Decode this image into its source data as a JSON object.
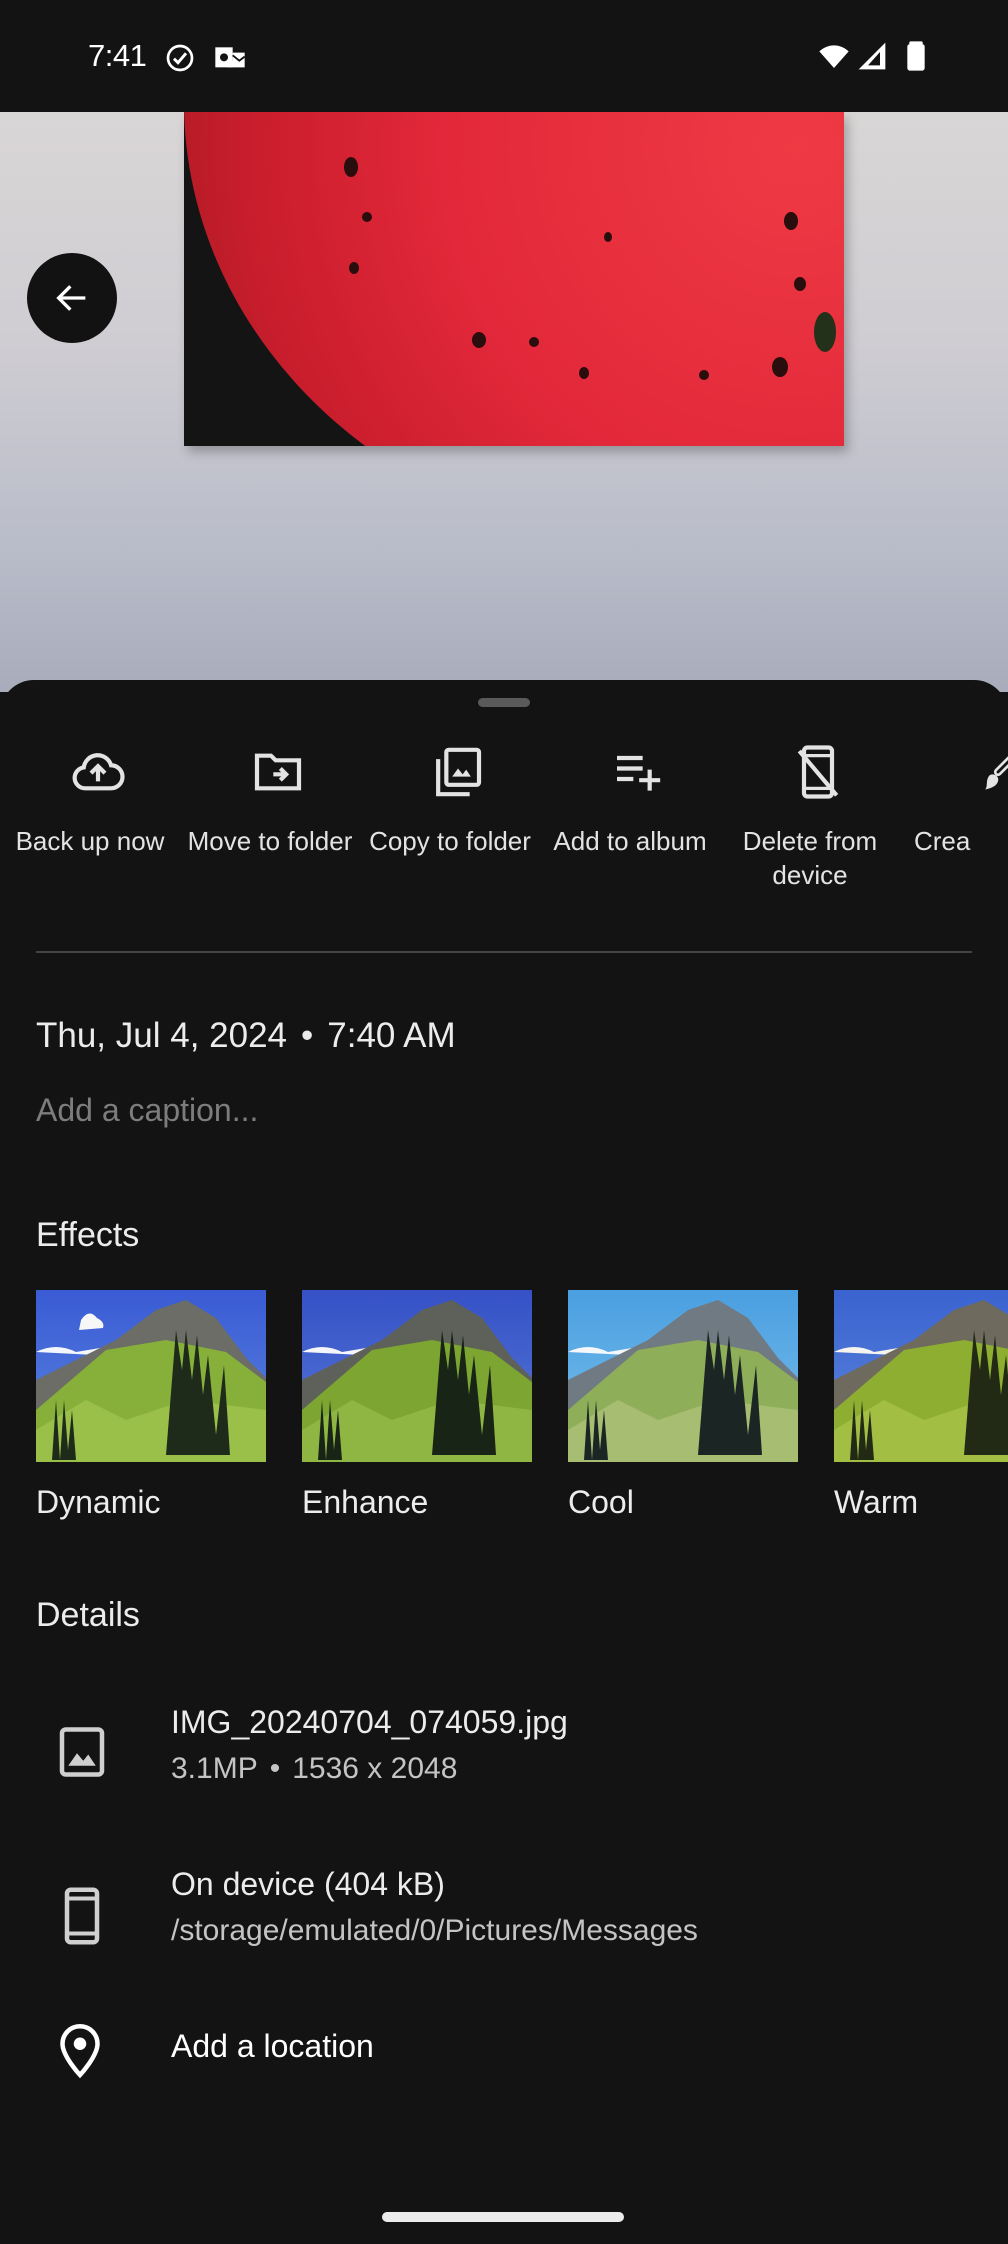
{
  "status_bar": {
    "time": "7:41",
    "left_icons": [
      "check-circle-icon",
      "outlook-icon"
    ],
    "right_icons": [
      "wifi-icon",
      "signal-icon",
      "battery-icon"
    ]
  },
  "photo": {
    "description": "Red and black poured-acrylic painting on a wall",
    "back_button": {
      "icon": "arrow-left-icon",
      "label": "Back"
    }
  },
  "actions": [
    {
      "icon": "cloud-upload-icon",
      "label": "Back up now"
    },
    {
      "icon": "folder-move-icon",
      "label": "Move to folder"
    },
    {
      "icon": "copy-to-folder-icon",
      "label": "Copy to folder"
    },
    {
      "icon": "playlist-add-icon",
      "label": "Add to album"
    },
    {
      "icon": "phone-off-icon",
      "label": "Delete from device"
    },
    {
      "icon": "brush-icon",
      "label": "Crea"
    }
  ],
  "info": {
    "date": "Thu, Jul 4, 2024",
    "separator": "•",
    "time": "7:40 AM",
    "caption_placeholder": "Add a caption..."
  },
  "effects": {
    "title": "Effects",
    "items": [
      {
        "label": "Dynamic",
        "sky": "#3f63d6"
      },
      {
        "label": "Enhance",
        "sky": "#3a56c9"
      },
      {
        "label": "Cool",
        "sky": "#4ea2e0"
      },
      {
        "label": "Warm",
        "sky": "#3d6ad2"
      }
    ]
  },
  "details": {
    "title": "Details",
    "file": {
      "icon": "image-icon",
      "name": "IMG_20240704_074059.jpg",
      "megapixels": "3.1MP",
      "separator": "•",
      "resolution": "1536 x 2048"
    },
    "storage": {
      "icon": "smartphone-icon",
      "title": "On device (404 kB)",
      "path": "/storage/emulated/0/Pictures/Messages"
    },
    "location": {
      "icon": "location-pin-icon",
      "label": "Add a location"
    }
  }
}
